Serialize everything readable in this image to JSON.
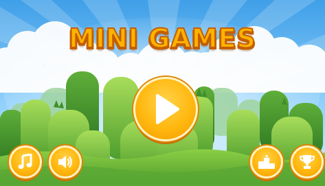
{
  "game": {
    "title": "MINI GAMES"
  },
  "buttons": {
    "play": {
      "icon": "play-icon"
    },
    "music": {
      "icon": "music-note-icon"
    },
    "sound": {
      "icon": "speaker-icon"
    },
    "leaderboard": {
      "icon": "podium-icon"
    },
    "achievements": {
      "icon": "trophy-icon"
    }
  },
  "colors": {
    "sky_top": "#3f9fe8",
    "sky_bottom": "#bfe6ff",
    "grass_dark": "#3f8f2a",
    "grass_light": "#8fd04a",
    "title_fill": "#ffb300",
    "title_outline": "#c45e00",
    "button_fill": "#ffb80f"
  }
}
